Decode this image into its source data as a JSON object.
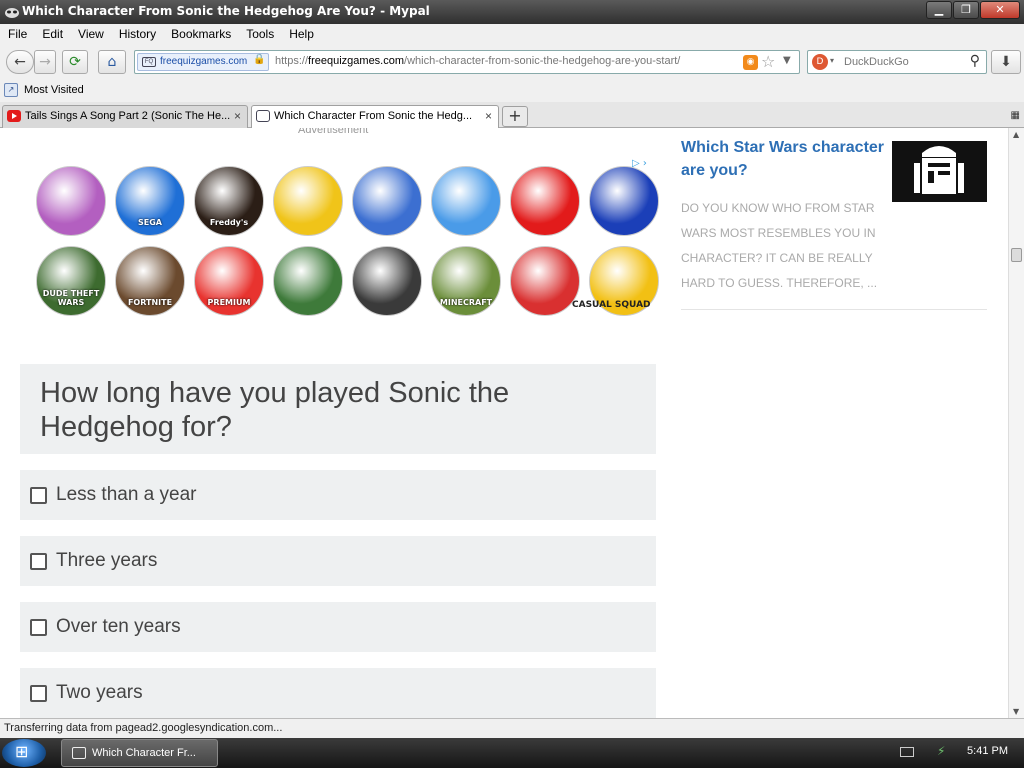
{
  "window": {
    "title": "Which Character From Sonic the Hedgehog Are You? - Mypal",
    "minimize": "▁",
    "restore": "❐",
    "close": "✕"
  },
  "menu": [
    "File",
    "Edit",
    "View",
    "History",
    "Bookmarks",
    "Tools",
    "Help"
  ],
  "nav": {
    "back": "←",
    "forward": "→",
    "reload": "⟳",
    "home": "⌂",
    "site_identity": "freequizgames.com",
    "url_scheme": "https://",
    "url_domain": "freequizgames.com",
    "url_path": "/which-character-from-sonic-the-hedgehog-are-you-start/",
    "search_placeholder": "DuckDuckGo",
    "search_icon": "⚲",
    "download_icon": "⬇"
  },
  "bookmarks": {
    "most_visited": "Most Visited"
  },
  "tabs": [
    {
      "label": "Tails Sings A Song Part 2 (Sonic The He...",
      "active": false
    },
    {
      "label": "Which Character From Sonic the Hedg...",
      "active": true
    }
  ],
  "tab_close": "×",
  "new_tab": "+",
  "content": {
    "advertisement_label": "Advertisement",
    "games": [
      {
        "label": "",
        "color": "#b35fc0"
      },
      {
        "label": "SEGA",
        "color": "#1f6fd6"
      },
      {
        "label": "Freddy's",
        "color": "#2b1e16"
      },
      {
        "label": "",
        "color": "#f0c419"
      },
      {
        "label": "",
        "color": "#3c6fd1"
      },
      {
        "label": "",
        "color": "#4a9be8"
      },
      {
        "label": "",
        "color": "#e21b1b"
      },
      {
        "label": "",
        "color": "#1b3fb8"
      },
      {
        "label": "DUDE THEFT WARS",
        "color": "#3d6b2f"
      },
      {
        "label": "FORTNITE",
        "color": "#6b4a2e"
      },
      {
        "label": "PREMIUM",
        "color": "#e8332f"
      },
      {
        "label": "",
        "color": "#3e7a3a"
      },
      {
        "label": "",
        "color": "#3a3a3a"
      },
      {
        "label": "MINECRAFT",
        "color": "#6b8e3a"
      },
      {
        "label": "",
        "color": "#d93030"
      },
      {
        "label": "",
        "color": "#f2c014"
      }
    ],
    "casual_squad": "CASUAL SQUAD",
    "sidebar_ad": {
      "title": "Which Star Wars character are you?",
      "description": "Do you know who from Star Wars most resembles you in character? It can be really hard to guess. Therefore, ..."
    },
    "question": "How long have you played Sonic the Hedgehog for?",
    "answers": [
      "Less than a year",
      "Three years",
      "Over ten years",
      "Two years"
    ]
  },
  "status": "Transferring data from pagead2.googlesyndication.com...",
  "taskbar": {
    "window_button": "Which Character Fr...",
    "clock": "5:41 PM"
  }
}
